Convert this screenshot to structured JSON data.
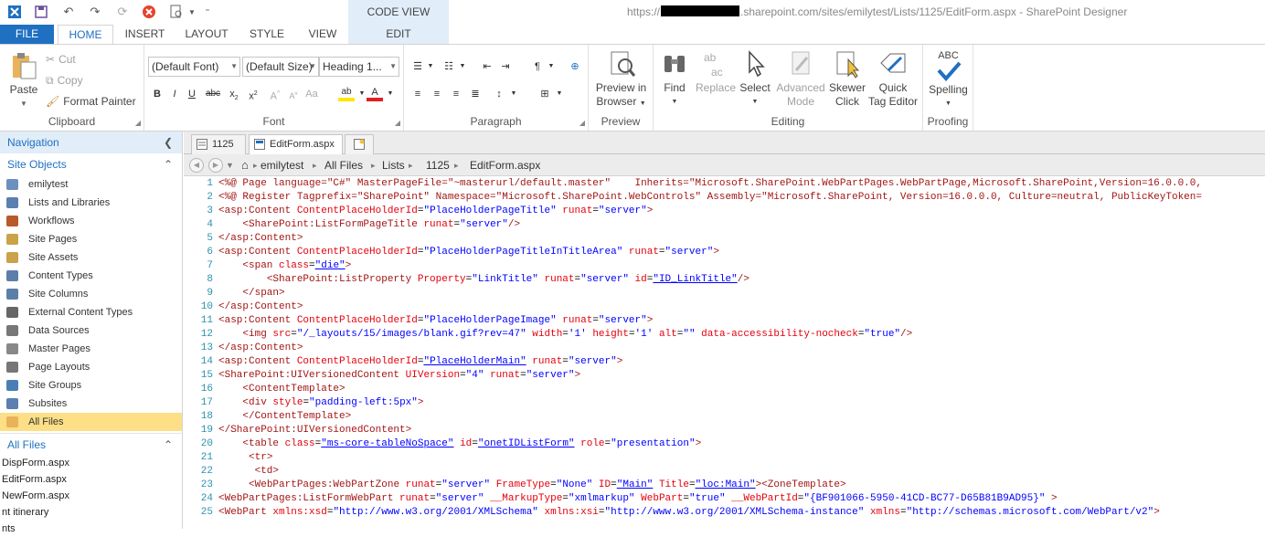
{
  "window": {
    "title_prefix": "https://",
    "title_suffix": ".sharepoint.com/sites/emilytest/Lists/1125/EditForm.aspx - SharePoint Designer",
    "context_tab_group": "CODE VIEW TOOLS"
  },
  "ribbon_tabs": [
    "FILE",
    "HOME",
    "INSERT",
    "LAYOUT",
    "STYLE",
    "VIEW",
    "EDIT"
  ],
  "clipboard": {
    "paste": "Paste",
    "cut": "Cut",
    "copy": "Copy",
    "format_painter": "Format Painter",
    "label": "Clipboard"
  },
  "font": {
    "family": "(Default Font)",
    "size": "(Default Size)",
    "style": "Heading 1...",
    "label": "Font"
  },
  "paragraph": {
    "label": "Paragraph"
  },
  "preview": {
    "browser": "Preview in",
    "browser2": "Browser",
    "label": "Preview"
  },
  "editing": {
    "find": "Find",
    "replace": "Replace",
    "select": "Select",
    "advanced": "Advanced",
    "advanced2": "Mode",
    "skewer": "Skewer",
    "skewer2": "Click",
    "quick": "Quick",
    "quick2": "Tag Editor",
    "label": "Editing"
  },
  "proofing": {
    "spelling": "Spelling",
    "abc": "ABC",
    "label": "Proofing"
  },
  "nav": {
    "title": "Navigation",
    "site_objects": "Site Objects",
    "items": [
      "emilytest",
      "Lists and Libraries",
      "Workflows",
      "Site Pages",
      "Site Assets",
      "Content Types",
      "Site Columns",
      "External Content Types",
      "Data Sources",
      "Master Pages",
      "Page Layouts",
      "Site Groups",
      "Subsites",
      "All Files"
    ],
    "all_files_header": "All Files",
    "files": [
      "DispForm.aspx",
      "EditForm.aspx",
      "NewForm.aspx",
      "nt itinerary",
      "nts"
    ]
  },
  "doc_tabs": [
    "1125",
    "EditForm.aspx"
  ],
  "breadcrumb": [
    "emilytest",
    "All Files",
    "Lists",
    "1125",
    "EditForm.aspx"
  ],
  "code_lines": [
    [
      [
        "tag",
        "<%@ Page language=\"C#\" MasterPageFile=\"~masterurl/default.master\"    Inherits=\"Microsoft.SharePoint.WebPartPages.WebPartPage,Microsoft.SharePoint,Version=16.0.0.0,"
      ]
    ],
    [
      [
        "tag",
        "<%@ Register Tagprefix=\"SharePoint\" Namespace=\"Microsoft.SharePoint.WebControls\" Assembly=\"Microsoft.SharePoint, Version=16.0.0.0, Culture=neutral, PublicKeyToken="
      ]
    ],
    [
      [
        "tag",
        "<asp:Content "
      ],
      [
        "attr",
        "ContentPlaceHolderId"
      ],
      [
        "txt",
        "="
      ],
      [
        "val",
        "\"PlaceHolderPageTitle\""
      ],
      [
        "attr",
        " runat"
      ],
      [
        "txt",
        "="
      ],
      [
        "val",
        "\"server\""
      ],
      [
        "tag",
        ">"
      ]
    ],
    [
      [
        "txt",
        "    "
      ],
      [
        "tag",
        "<SharePoint:ListFormPageTitle "
      ],
      [
        "attr",
        "runat"
      ],
      [
        "txt",
        "="
      ],
      [
        "val",
        "\"server\""
      ],
      [
        "tag",
        "/>"
      ]
    ],
    [
      [
        "tag",
        "</asp:Content>"
      ]
    ],
    [
      [
        "tag",
        "<asp:Content "
      ],
      [
        "attr",
        "ContentPlaceHolderId"
      ],
      [
        "txt",
        "="
      ],
      [
        "val",
        "\"PlaceHolderPageTitleInTitleArea\""
      ],
      [
        "attr",
        " runat"
      ],
      [
        "txt",
        "="
      ],
      [
        "val",
        "\"server\""
      ],
      [
        "tag",
        ">"
      ]
    ],
    [
      [
        "txt",
        "    "
      ],
      [
        "tag",
        "<span "
      ],
      [
        "attr",
        "class"
      ],
      [
        "txt",
        "="
      ],
      [
        "val",
        "\"die\""
      ],
      [
        "tag",
        ">"
      ]
    ],
    [
      [
        "txt",
        "        "
      ],
      [
        "tag",
        "<SharePoint:ListProperty "
      ],
      [
        "attr",
        "Property"
      ],
      [
        "txt",
        "="
      ],
      [
        "val",
        "\"LinkTitle\""
      ],
      [
        "attr",
        " runat"
      ],
      [
        "txt",
        "="
      ],
      [
        "val",
        "\"server\""
      ],
      [
        "attr",
        " id"
      ],
      [
        "txt",
        "="
      ],
      [
        "val",
        "\"ID_LinkTitle\""
      ],
      [
        "tag",
        "/>"
      ]
    ],
    [
      [
        "txt",
        "    "
      ],
      [
        "tag",
        "</span>"
      ]
    ],
    [
      [
        "tag",
        "</asp:Content>"
      ]
    ],
    [
      [
        "tag",
        "<asp:Content "
      ],
      [
        "attr",
        "ContentPlaceHolderId"
      ],
      [
        "txt",
        "="
      ],
      [
        "val",
        "\"PlaceHolderPageImage\""
      ],
      [
        "attr",
        " runat"
      ],
      [
        "txt",
        "="
      ],
      [
        "val",
        "\"server\""
      ],
      [
        "tag",
        ">"
      ]
    ],
    [
      [
        "txt",
        "    "
      ],
      [
        "tag",
        "<img "
      ],
      [
        "attr",
        "src"
      ],
      [
        "txt",
        "="
      ],
      [
        "val",
        "\"/_layouts/15/images/blank.gif?rev=47\""
      ],
      [
        "attr",
        " width"
      ],
      [
        "txt",
        "="
      ],
      [
        "val",
        "'1'"
      ],
      [
        "attr",
        " height"
      ],
      [
        "txt",
        "="
      ],
      [
        "val",
        "'1'"
      ],
      [
        "attr",
        " alt"
      ],
      [
        "txt",
        "="
      ],
      [
        "val",
        "\"\""
      ],
      [
        "attr",
        " data-accessibility-nocheck"
      ],
      [
        "txt",
        "="
      ],
      [
        "val",
        "\"true\""
      ],
      [
        "tag",
        "/>"
      ]
    ],
    [
      [
        "tag",
        "</asp:Content>"
      ]
    ],
    [
      [
        "tag",
        "<asp:Content "
      ],
      [
        "attr",
        "ContentPlaceHolderId"
      ],
      [
        "txt",
        "="
      ],
      [
        "val",
        "\"PlaceHolderMain\""
      ],
      [
        "attr",
        " runat"
      ],
      [
        "txt",
        "="
      ],
      [
        "val",
        "\"server\""
      ],
      [
        "tag",
        ">"
      ]
    ],
    [
      [
        "tag",
        "<SharePoint:UIVersionedContent "
      ],
      [
        "attr",
        "UIVersion"
      ],
      [
        "txt",
        "="
      ],
      [
        "val",
        "\"4\""
      ],
      [
        "attr",
        " runat"
      ],
      [
        "txt",
        "="
      ],
      [
        "val",
        "\"server\""
      ],
      [
        "tag",
        ">"
      ]
    ],
    [
      [
        "txt",
        "    "
      ],
      [
        "tag",
        "<ContentTemplate>"
      ]
    ],
    [
      [
        "txt",
        "    "
      ],
      [
        "tag",
        "<div "
      ],
      [
        "attr",
        "style"
      ],
      [
        "txt",
        "="
      ],
      [
        "val",
        "\"padding-left:5px\""
      ],
      [
        "tag",
        ">"
      ]
    ],
    [
      [
        "txt",
        "    "
      ],
      [
        "tag",
        "</ContentTemplate>"
      ]
    ],
    [
      [
        "tag",
        "</SharePoint:UIVersionedContent>"
      ]
    ],
    [
      [
        "txt",
        "    "
      ],
      [
        "tag",
        "<table "
      ],
      [
        "attr",
        "class"
      ],
      [
        "txt",
        "="
      ],
      [
        "val",
        "\"ms-core-tableNoSpace\""
      ],
      [
        "attr",
        " id"
      ],
      [
        "txt",
        "="
      ],
      [
        "val",
        "\"onetIDListForm\""
      ],
      [
        "attr",
        " role"
      ],
      [
        "txt",
        "="
      ],
      [
        "val",
        "\"presentation\""
      ],
      [
        "tag",
        ">"
      ]
    ],
    [
      [
        "txt",
        "     "
      ],
      [
        "tag",
        "<tr>"
      ]
    ],
    [
      [
        "txt",
        "      "
      ],
      [
        "tag",
        "<td>"
      ]
    ],
    [
      [
        "txt",
        "     "
      ],
      [
        "tag",
        "<WebPartPages:WebPartZone "
      ],
      [
        "attr",
        "runat"
      ],
      [
        "txt",
        "="
      ],
      [
        "val",
        "\"server\""
      ],
      [
        "attr",
        " FrameType"
      ],
      [
        "txt",
        "="
      ],
      [
        "val",
        "\"None\""
      ],
      [
        "attr",
        " ID"
      ],
      [
        "txt",
        "="
      ],
      [
        "val",
        "\"Main\""
      ],
      [
        "attr",
        " Title"
      ],
      [
        "txt",
        "="
      ],
      [
        "val",
        "\"loc:Main\""
      ],
      [
        "tag",
        "><ZoneTemplate>"
      ]
    ],
    [
      [
        "tag",
        "<WebPartPages:ListFormWebPart "
      ],
      [
        "attr",
        "runat"
      ],
      [
        "txt",
        "="
      ],
      [
        "val",
        "\"server\""
      ],
      [
        "attr",
        " __MarkupType"
      ],
      [
        "txt",
        "="
      ],
      [
        "val",
        "\"xmlmarkup\""
      ],
      [
        "attr",
        " WebPart"
      ],
      [
        "txt",
        "="
      ],
      [
        "val",
        "\"true\""
      ],
      [
        "attr",
        " __WebPartId"
      ],
      [
        "txt",
        "="
      ],
      [
        "val",
        "\"{BF901066-5950-41CD-BC77-D65B81B9AD95}\""
      ],
      [
        "tag",
        " >"
      ]
    ],
    [
      [
        "tag",
        "<WebPart "
      ],
      [
        "attr",
        "xmlns:xsd"
      ],
      [
        "txt",
        "="
      ],
      [
        "val",
        "\"http://www.w3.org/2001/XMLSchema\""
      ],
      [
        "attr",
        " xmlns:xsi"
      ],
      [
        "txt",
        "="
      ],
      [
        "val",
        "\"http://www.w3.org/2001/XMLSchema-instance\""
      ],
      [
        "attr",
        " xmlns"
      ],
      [
        "txt",
        "="
      ],
      [
        "val",
        "\"http://schemas.microsoft.com/WebPart/v2\""
      ],
      [
        "tag",
        ">"
      ]
    ]
  ],
  "colors": {
    "accent": "#1f70c1",
    "selected": "#fcdf87",
    "context": "#e1edf8"
  }
}
